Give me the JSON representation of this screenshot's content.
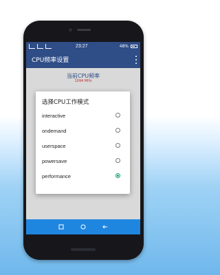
{
  "statusbar": {
    "time": "23:27",
    "battery": "48%"
  },
  "appbar": {
    "title": "CPU频率设置",
    "menu_icon": "overflow-menu-icon"
  },
  "content": {
    "freq_title": "当前CPU频率",
    "freq_value": "1094 MHz"
  },
  "dialog": {
    "title": "选择CPU工作模式",
    "options": [
      {
        "label": "interactive",
        "selected": false
      },
      {
        "label": "ondemand",
        "selected": false
      },
      {
        "label": "userspace",
        "selected": false
      },
      {
        "label": "powersave",
        "selected": false
      },
      {
        "label": "performance",
        "selected": true
      }
    ]
  },
  "navbar": {
    "icons": [
      "recent-apps-icon",
      "home-icon",
      "back-icon"
    ]
  },
  "colors": {
    "primary": "#2f4d86",
    "accent": "#1a9e7a",
    "navbar": "#1f86e0"
  }
}
